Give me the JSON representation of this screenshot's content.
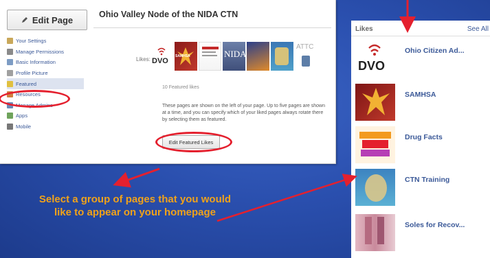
{
  "admin_panel": {
    "edit_page_button": "Edit Page",
    "nav_items": [
      {
        "label": "Your Settings",
        "icon": "settings-icon"
      },
      {
        "label": "Manage Permissions",
        "icon": "permissions-icon"
      },
      {
        "label": "Basic Information",
        "icon": "info-icon"
      },
      {
        "label": "Profile Picture",
        "icon": "picture-icon"
      },
      {
        "label": "Featured",
        "icon": "star-icon"
      },
      {
        "label": "Resources",
        "icon": "resources-icon"
      },
      {
        "label": "Manage Admins",
        "icon": "admins-icon"
      },
      {
        "label": "Apps",
        "icon": "apps-icon"
      },
      {
        "label": "Mobile",
        "icon": "mobile-icon"
      }
    ],
    "page_title": "Ohio Valley Node of the NIDA CTN",
    "likes_label": "Likes:",
    "thumb_labels": [
      "DVO",
      "SAMHSA",
      "",
      "NIDA",
      "",
      "",
      "ATTC"
    ],
    "featured_count": "10 Featured likes",
    "description": "These pages are shown on the left of your page. Up to five pages are shown at a time, and you can specify which of your liked pages always rotate there by selecting them as featured.",
    "edit_featured_likes_button": "Edit Featured Likes"
  },
  "caption": {
    "line1": "Select a group of pages that you would",
    "line2": "like to appear on your homepage"
  },
  "likes_panel": {
    "title": "Likes",
    "see_all": "See All",
    "items": [
      {
        "name": "Ohio Citizen Ad..."
      },
      {
        "name": "SAMHSA"
      },
      {
        "name": "Drug Facts"
      },
      {
        "name": "CTN Training"
      },
      {
        "name": "Soles for Recov..."
      }
    ]
  },
  "colors": {
    "highlight_red": "#e4202e",
    "caption_orange": "#f0a21a",
    "fb_link_blue": "#3b5998"
  }
}
